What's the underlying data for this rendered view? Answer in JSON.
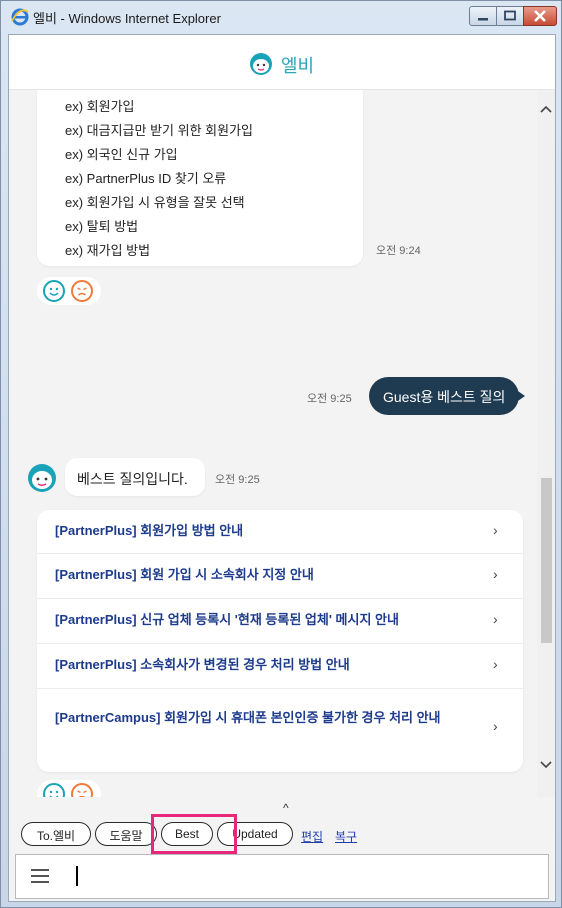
{
  "window": {
    "title": "엘비 - Windows Internet Explorer"
  },
  "app": {
    "title": "엘비"
  },
  "chat": {
    "examples": [
      "ex) 회원가입",
      "ex) 대금지급만 받기 위한 회원가입",
      "ex) 외국인 신규 가입",
      "ex) PartnerPlus ID 찾기 오류",
      "ex) 회원가입 시 유형을 잘못 선택",
      "ex) 탈퇴 방법",
      "ex) 재가입 방법"
    ],
    "examples_time": "오전 9:24",
    "user_message": "Guest용 베스트 질의",
    "user_time": "오전 9:25",
    "bot_message": "베스트 질의입니다.",
    "bot_time": "오전 9:25",
    "list_items": [
      "[PartnerPlus] 회원가입 방법 안내",
      "[PartnerPlus] 회원 가입 시 소속회사 지정 안내",
      "[PartnerPlus] 신규 업체 등록시 '현재 등록된 업체' 메시지 안내",
      "[PartnerPlus] 소속회사가 변경된 경우 처리 방법 안내",
      "[PartnerCampus] 회원가입 시 휴대폰 본인인증 불가한 경우 처리 안내"
    ],
    "chevron": "›",
    "collapse_icon": "^"
  },
  "footer": {
    "chips": [
      "To.엘비",
      "도움말",
      "Best",
      "Updated"
    ],
    "links": [
      "편집",
      "복구"
    ],
    "input_value": ""
  },
  "colors": {
    "accent": "#19a3b8",
    "user_bubble": "#1f3b51",
    "link": "#1d3b8c",
    "highlight": "#e6277a",
    "sad": "#ef7a3b"
  }
}
